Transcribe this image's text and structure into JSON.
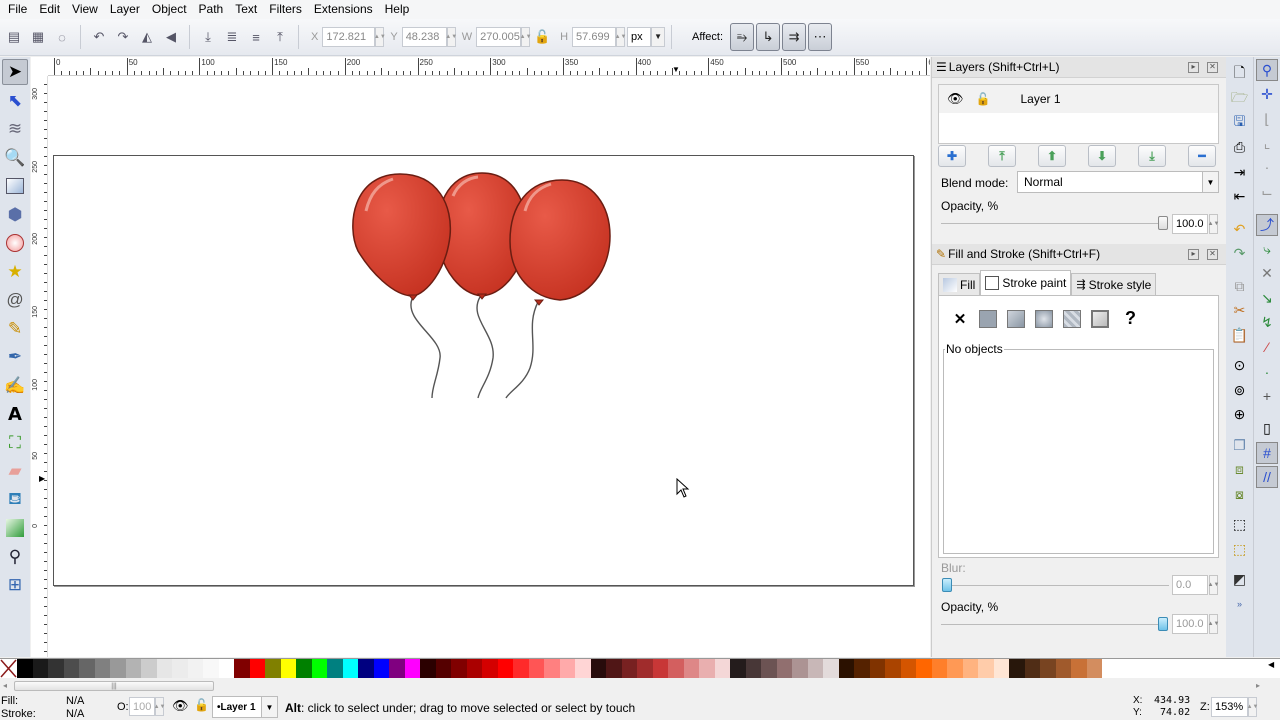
{
  "menu": [
    "File",
    "Edit",
    "View",
    "Layer",
    "Object",
    "Path",
    "Text",
    "Filters",
    "Extensions",
    "Help"
  ],
  "toolbar": {
    "select_icons": [
      "select-all-icon",
      "select-all-in-all-layers-icon",
      "deselect-icon"
    ],
    "transform_icons": [
      "rotate-ccw-icon",
      "rotate-cw-icon",
      "flip-horizontal-icon",
      "flip-vertical-icon"
    ],
    "arrange_icons": [
      "lower-to-bottom-icon",
      "lower-icon",
      "raise-icon",
      "raise-to-top-icon"
    ],
    "x_label": "X",
    "x_value": "172.821",
    "y_label": "Y",
    "y_value": "48.238",
    "w_label": "W",
    "w_value": "270.005",
    "h_label": "H",
    "h_value": "57.699",
    "unit": "px",
    "affect_label": "Affect:"
  },
  "tools": [
    "select-tool",
    "node-tool",
    "tweak-tool",
    "zoom-tool",
    "rectangle-tool",
    "3d-box-tool",
    "ellipse-tool",
    "star-tool",
    "spiral-tool",
    "pencil-tool",
    "pen-tool",
    "calligraphy-tool",
    "text-tool",
    "spray-tool",
    "eraser-tool",
    "paint-bucket-tool",
    "gradient-tool",
    "dropper-tool",
    "connector-tool"
  ],
  "ruler": {
    "h_labels": [
      "0",
      "50",
      "100",
      "150",
      "200",
      "250",
      "300",
      "350",
      "400",
      "450",
      "500",
      "550",
      "60"
    ],
    "v_labels": [
      "300",
      "250",
      "200",
      "150",
      "100",
      "50",
      "0"
    ]
  },
  "layers_panel": {
    "title": "Layers (Shift+Ctrl+L)",
    "layer_name": "Layer 1",
    "blend_label": "Blend mode:",
    "blend_value": "Normal",
    "opacity_label": "Opacity, %",
    "opacity_value": "100.0",
    "opacity_fraction": 1.0
  },
  "fill_stroke_panel": {
    "title": "Fill and Stroke (Shift+Ctrl+F)",
    "tabs": [
      "Fill",
      "Stroke paint",
      "Stroke style"
    ],
    "active_tab": "Stroke paint",
    "no_objects": "No objects",
    "unset_label": "?",
    "none_label": "✕",
    "blur_label": "Blur:",
    "blur_value": "0.0",
    "blur_fraction": 0.0,
    "opacity_label": "Opacity, %",
    "opacity_value": "100.0",
    "opacity_fraction": 1.0
  },
  "palette": [
    "#000000",
    "#1a1a1a",
    "#333333",
    "#4d4d4d",
    "#666666",
    "#808080",
    "#999999",
    "#b3b3b3",
    "#cccccc",
    "#e6e6e6",
    "#ececec",
    "#f2f2f2",
    "#f8f8f8",
    "#ffffff",
    "#800000",
    "#ff0000",
    "#808000",
    "#ffff00",
    "#008000",
    "#00ff00",
    "#008080",
    "#00ffff",
    "#000080",
    "#0000ff",
    "#800080",
    "#ff00ff",
    "#2b0000",
    "#550000",
    "#800000",
    "#aa0000",
    "#d40000",
    "#ff0000",
    "#ff2a2a",
    "#ff5555",
    "#ff8080",
    "#ffaaaa",
    "#ffd5d5",
    "#280b0b",
    "#501616",
    "#782121",
    "#a02c2c",
    "#c83737",
    "#d35f5f",
    "#de8787",
    "#e9afaf",
    "#f4d7d7",
    "#241c1c",
    "#483737",
    "#6c5353",
    "#916f6f",
    "#ac9393",
    "#c8b7b7",
    "#e3dbdb",
    "#2b1100",
    "#552200",
    "#803300",
    "#aa4400",
    "#d45500",
    "#ff6600",
    "#ff7f2a",
    "#ff9955",
    "#ffb380",
    "#ffccaa",
    "#ffe6d5",
    "#28170b",
    "#502d16",
    "#784421",
    "#a05a2c",
    "#c87137",
    "#d38d5f"
  ],
  "status": {
    "fill_label": "Fill:",
    "fill_value": "N/A",
    "stroke_label": "Stroke:",
    "stroke_value": "N/A",
    "opacity_label": "O:",
    "opacity_value": "100",
    "layer": "•Layer 1",
    "message_bold": "Alt",
    "message": ": click to select under; drag to move selected or select by touch",
    "x_label": "X:",
    "x_value": "434.93",
    "y_label": "Y:",
    "y_value": "74.02",
    "zoom_label": "Z:",
    "zoom_value": "153%"
  }
}
